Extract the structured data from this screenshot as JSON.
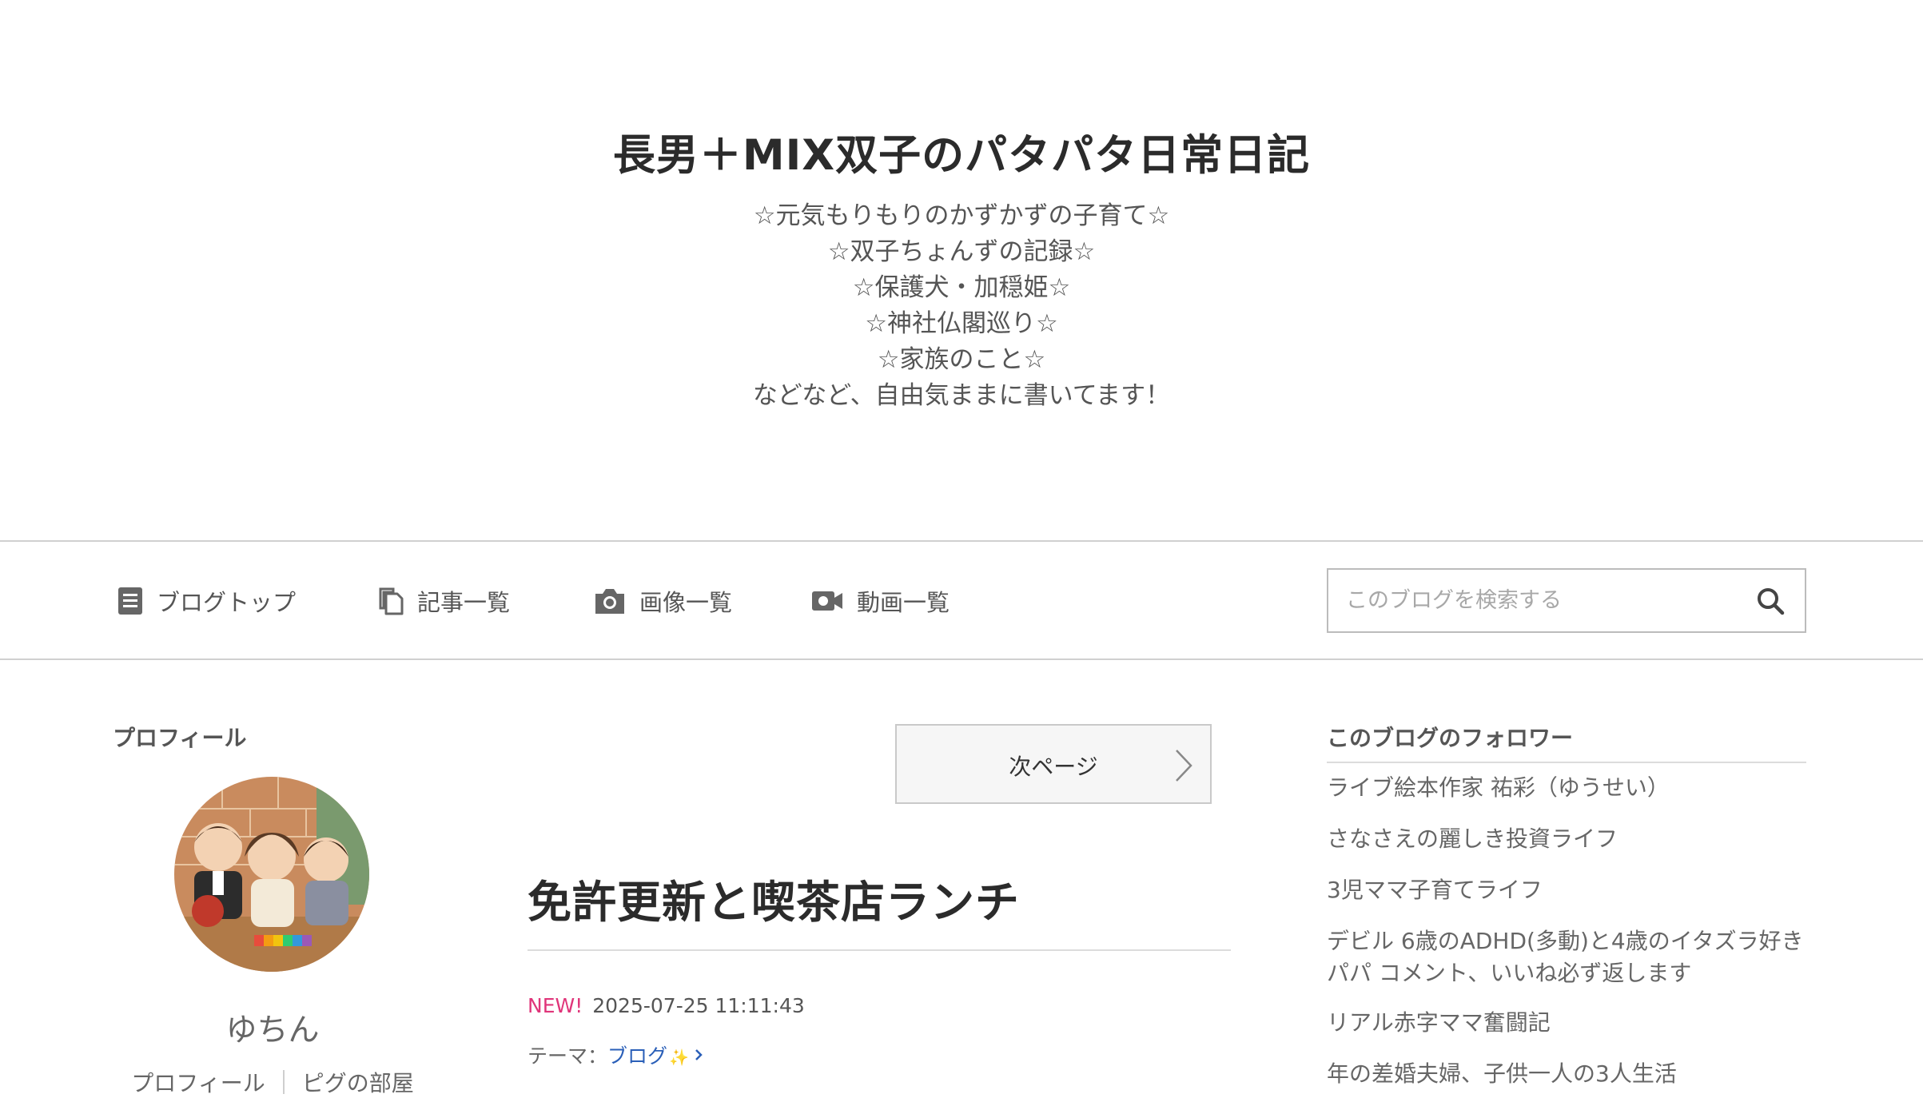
{
  "header": {
    "title": "長男＋MIX双子のパタパタ日常日記",
    "description": [
      "☆元気もりもりのかずかずの子育て☆",
      "☆双子ちょんずの記録☆",
      "☆保護犬・加穏姫☆",
      "☆神社仏閣巡り☆",
      "☆家族のこと☆",
      "などなど、自由気ままに書いてます！"
    ]
  },
  "nav": {
    "items": [
      {
        "label": "ブログトップ",
        "icon": "document-icon"
      },
      {
        "label": "記事一覧",
        "icon": "copy-icon"
      },
      {
        "label": "画像一覧",
        "icon": "camera-icon"
      },
      {
        "label": "動画一覧",
        "icon": "video-icon"
      }
    ],
    "search": {
      "placeholder": "このブログを検索する",
      "icon": "search-icon"
    }
  },
  "profile": {
    "heading": "プロフィール",
    "name": "ゆちん",
    "links": [
      "プロフィール",
      "ピグの部屋"
    ]
  },
  "main": {
    "next_page_label": "次ページ",
    "article": {
      "title": "免許更新と喫茶店ランチ",
      "new_badge": "NEW!",
      "date": "2025-07-25 11:11:43",
      "theme_prefix": "テーマ：",
      "theme": "ブログ",
      "theme_emoji": "✨"
    }
  },
  "followers": {
    "heading": "このブログのフォロワー",
    "items": [
      "ライブ絵本作家 祐彩（ゆうせい）",
      "さなさえの麗しき投資ライフ",
      "3児ママ子育てライフ",
      "デビル 6歳のADHD(多動)と4歳のイタズラ好きパパ コメント、いいね必ず返します",
      "リアル赤字ママ奮闘記",
      "年の差婚夫婦、子供一人の3人生活"
    ]
  },
  "colors": {
    "text": "#333333",
    "muted": "#666666",
    "border": "#d0d0d0",
    "new_badge": "#e0357a",
    "link": "#2a5fb8"
  }
}
